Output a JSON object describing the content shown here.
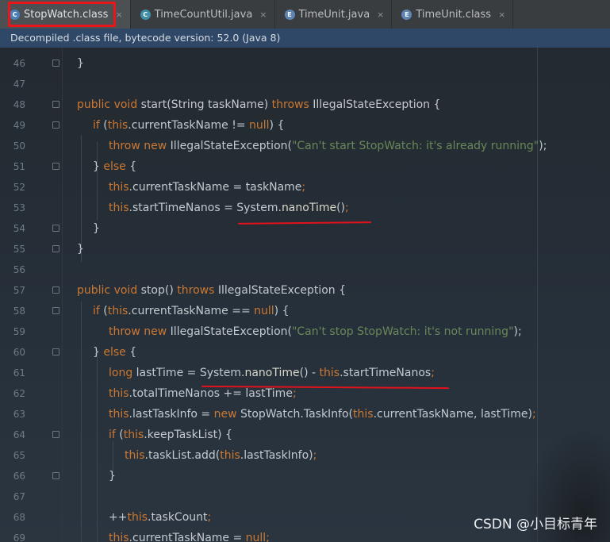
{
  "tabs": [
    {
      "label": "StopWatch.class",
      "icon": "class-file-icon",
      "active": true
    },
    {
      "label": "TimeCountUtil.java",
      "icon": "java-class-icon",
      "active": false
    },
    {
      "label": "TimeUnit.java",
      "icon": "enum-icon",
      "active": false
    },
    {
      "label": "TimeUnit.class",
      "icon": "enum-class-icon",
      "active": false
    }
  ],
  "tab_close_glyph": "×",
  "notice": "Decompiled .class file, bytecode version: 52.0 (Java 8)",
  "line_numbers": [
    "46",
    "47",
    "48",
    "49",
    "50",
    "51",
    "52",
    "53",
    "54",
    "55",
    "56",
    "57",
    "58",
    "59",
    "60",
    "61",
    "62",
    "63",
    "64",
    "65",
    "66",
    "67",
    "68",
    "69"
  ],
  "watermark": "CSDN @小目标青年",
  "colors": {
    "keyword": "#cc7832",
    "string": "#6a8759",
    "text": "#c3c9cf",
    "highlight_box": "#e8161a",
    "annotation": "#e2121c"
  }
}
